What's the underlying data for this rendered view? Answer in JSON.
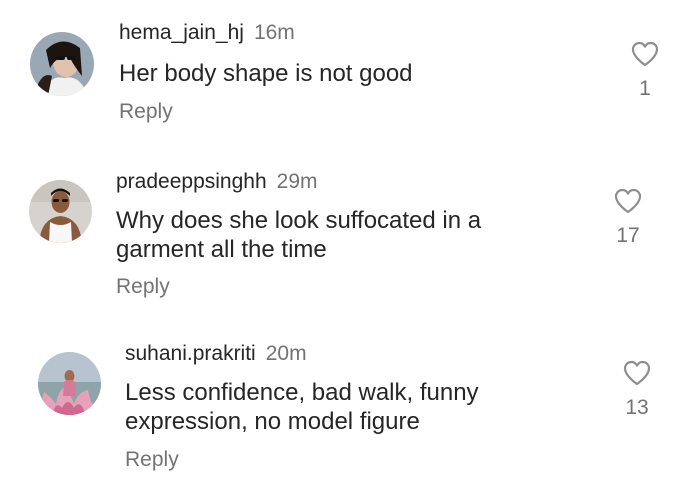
{
  "comments": [
    {
      "username": "hema_jain_hj",
      "time": "16m",
      "text": "Her body shape is not good",
      "reply_label": "Reply",
      "like_count": "1",
      "like_icon": "heart-outline-icon"
    },
    {
      "username": "pradeeppsinghh",
      "time": "29m",
      "text": "Why does she look suffocated in a garment all the time",
      "reply_label": "Reply",
      "like_count": "17",
      "like_icon": "heart-outline-icon"
    },
    {
      "username": "suhani.prakriti",
      "time": "20m",
      "text": "Less confidence, bad walk, funny expression, no model figure",
      "reply_label": "Reply",
      "like_count": "13",
      "like_icon": "heart-outline-icon"
    }
  ],
  "colors": {
    "primary_text": "#262626",
    "secondary_text": "#737373",
    "icon": "#8e8e8e"
  }
}
